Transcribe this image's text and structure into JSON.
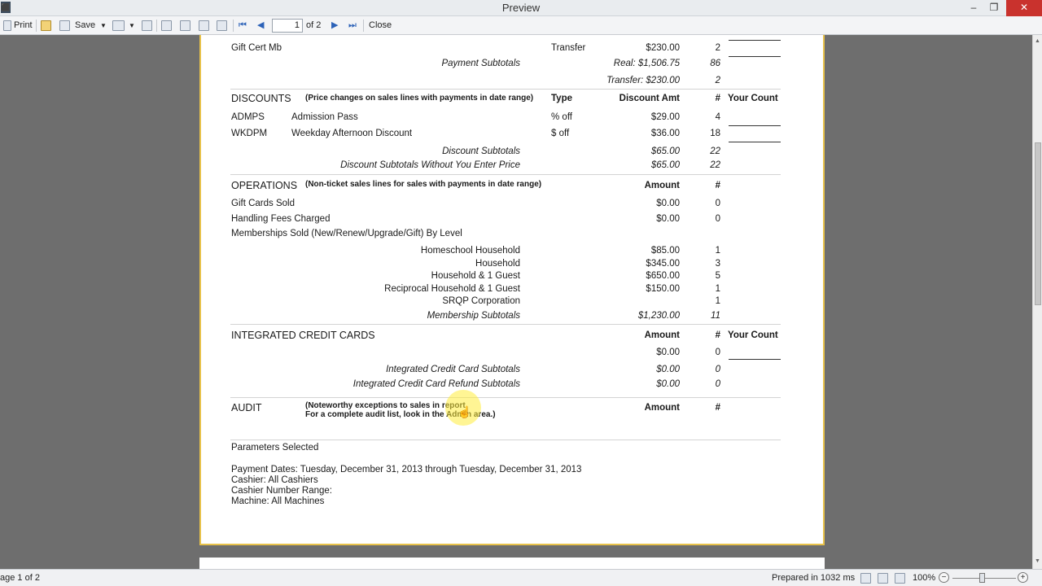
{
  "window": {
    "title": "Preview",
    "minimize": "–",
    "maximize": "❐",
    "close": "✕"
  },
  "toolbar": {
    "print": "Print",
    "save": "Save",
    "page_current": "1",
    "page_of": "of 2",
    "close": "Close"
  },
  "report": {
    "top": {
      "gift_cert": "Gift Cert Mb",
      "transfer": "Transfer",
      "transfer_amt": "$230.00",
      "transfer_count": "2",
      "payment_subtotals": "Payment Subtotals",
      "real_amt": "Real: $1,506.75",
      "real_count": "86",
      "transfer_sub_amt": "Transfer: $230.00",
      "transfer_sub_count": "2"
    },
    "discounts": {
      "title": "DISCOUNTS",
      "note": "(Price changes on sales lines with payments in date range)",
      "h_type": "Type",
      "h_amt": "Discount Amt",
      "h_count": "#",
      "h_your": "Your Count",
      "rows": [
        {
          "code": "ADMPS",
          "name": "Admission Pass",
          "type": "% off",
          "amt": "$29.00",
          "count": "4"
        },
        {
          "code": "WKDPM",
          "name": "Weekday Afternoon Discount",
          "type": "$ off",
          "amt": "$36.00",
          "count": "18"
        }
      ],
      "subtotal_label": "Discount Subtotals",
      "subtotal_amt": "$65.00",
      "subtotal_count": "22",
      "subtotal2_label": "Discount Subtotals Without You Enter Price",
      "subtotal2_amt": "$65.00",
      "subtotal2_count": "22"
    },
    "operations": {
      "title": "OPERATIONS",
      "note": "(Non-ticket sales lines for sales with payments in date range)",
      "h_amt": "Amount",
      "h_count": "#",
      "gift_cards": "Gift Cards Sold",
      "gift_amt": "$0.00",
      "gift_count": "0",
      "handling": "Handling Fees Charged",
      "handling_amt": "$0.00",
      "handling_count": "0",
      "memberships": "Memberships Sold (New/Renew/Upgrade/Gift) By Level",
      "levels": [
        {
          "name": "Homeschool Household",
          "amt": "$85.00",
          "count": "1"
        },
        {
          "name": "Household",
          "amt": "$345.00",
          "count": "3"
        },
        {
          "name": "Household & 1 Guest",
          "amt": "$650.00",
          "count": "5"
        },
        {
          "name": "Reciprocal Household & 1 Guest",
          "amt": "$150.00",
          "count": "1"
        },
        {
          "name": "SRQP Corporation",
          "amt": "",
          "count": "1"
        }
      ],
      "subtotal_label": "Membership Subtotals",
      "subtotal_amt": "$1,230.00",
      "subtotal_count": "11"
    },
    "icc": {
      "title": "INTEGRATED CREDIT CARDS",
      "h_amt": "Amount",
      "h_count": "#",
      "h_your": "Your Count",
      "row_amt": "$0.00",
      "row_count": "0",
      "sub1_label": "Integrated Credit Card Subtotals",
      "sub1_amt": "$0.00",
      "sub1_count": "0",
      "sub2_label": "Integrated Credit Card Refund Subtotals",
      "sub2_amt": "$0.00",
      "sub2_count": "0"
    },
    "audit": {
      "title": "AUDIT",
      "note1": "(Noteworthy exceptions to sales in report.",
      "note2": "For a complete audit list, look in the Admin area.)",
      "h_amt": "Amount",
      "h_count": "#"
    },
    "params": {
      "title": "Parameters Selected",
      "dates": "Payment Dates: Tuesday, December 31, 2013 through Tuesday, December 31, 2013",
      "cashier": "Cashier: All Cashiers",
      "range": "Cashier Number Range:",
      "machine": "Machine: All Machines"
    }
  },
  "status": {
    "page": "age 1 of 2",
    "prepared": "Prepared in 1032 ms",
    "zoom": "100%"
  }
}
